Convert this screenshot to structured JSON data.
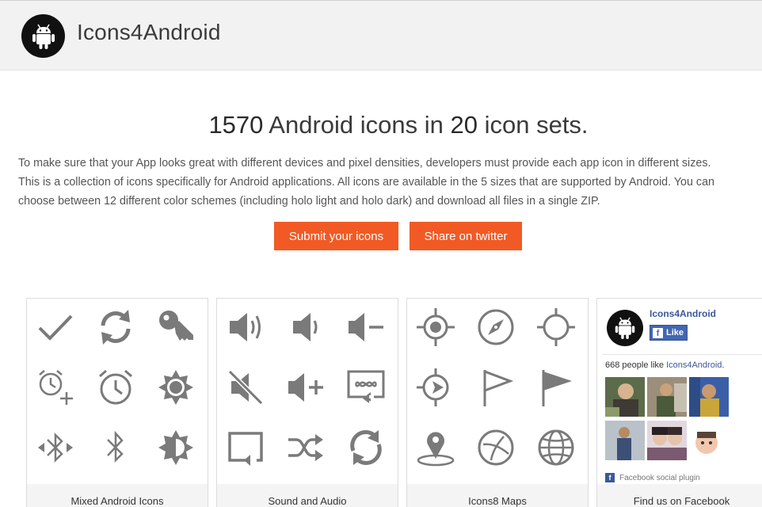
{
  "header": {
    "site_title": "Icons4Android",
    "logo_icon": "android-robot-icon"
  },
  "hero": {
    "headline_count": "1570",
    "headline_mid": " Android icons in ",
    "headline_sets": "20",
    "headline_end": " icon sets.",
    "intro_lines": [
      "To make sure that your App looks great with different devices and pixel densities, developers must provide each app icon in different sizes.",
      "This is a collection of icons specifically for Android applications. All icons are available in the 5 sizes that are supported by Android. You can",
      "choose between 12 different color schemes (including holo light and holo dark) and download all files in a single ZIP."
    ],
    "submit_label": "Submit your icons",
    "twitter_label": "Share on twitter"
  },
  "colors": {
    "accent": "#f15a24",
    "icon_gray": "#7a7a7a",
    "facebook_blue": "#3b5998"
  },
  "icon_sets": [
    {
      "title": "Mixed Android Icons",
      "icons": [
        "checkmark-icon",
        "refresh-icon",
        "key-icon",
        "add-alarm-icon",
        "alarm-clock-icon",
        "brightness-high-icon",
        "bluetooth-connected-icon",
        "bluetooth-icon",
        "brightness-half-icon"
      ]
    },
    {
      "title": "Sound and Audio",
      "icons": [
        "volume-up-icon",
        "volume-low-icon",
        "volume-minus-icon",
        "volume-mute-icon",
        "volume-plus-icon",
        "loop-repeat-icon",
        "repeat-icon",
        "shuffle-icon",
        "sync-icon"
      ]
    },
    {
      "title": "Icons8 Maps",
      "icons": [
        "gps-fixed-icon",
        "compass-icon",
        "gps-target-icon",
        "gps-direction-icon",
        "flag-outline-icon",
        "flag-filled-icon",
        "map-marker-icon",
        "compass-rose-icon",
        "globe-icon"
      ]
    }
  ],
  "facebook": {
    "page_name": "Icons4Android",
    "like_label": "Like",
    "like_count_text": "668 people like ",
    "like_page_link": "Icons4Android",
    "like_count_suffix": ".",
    "plugin_label": "Facebook social plugin",
    "footer_title": "Find us on Facebook"
  }
}
